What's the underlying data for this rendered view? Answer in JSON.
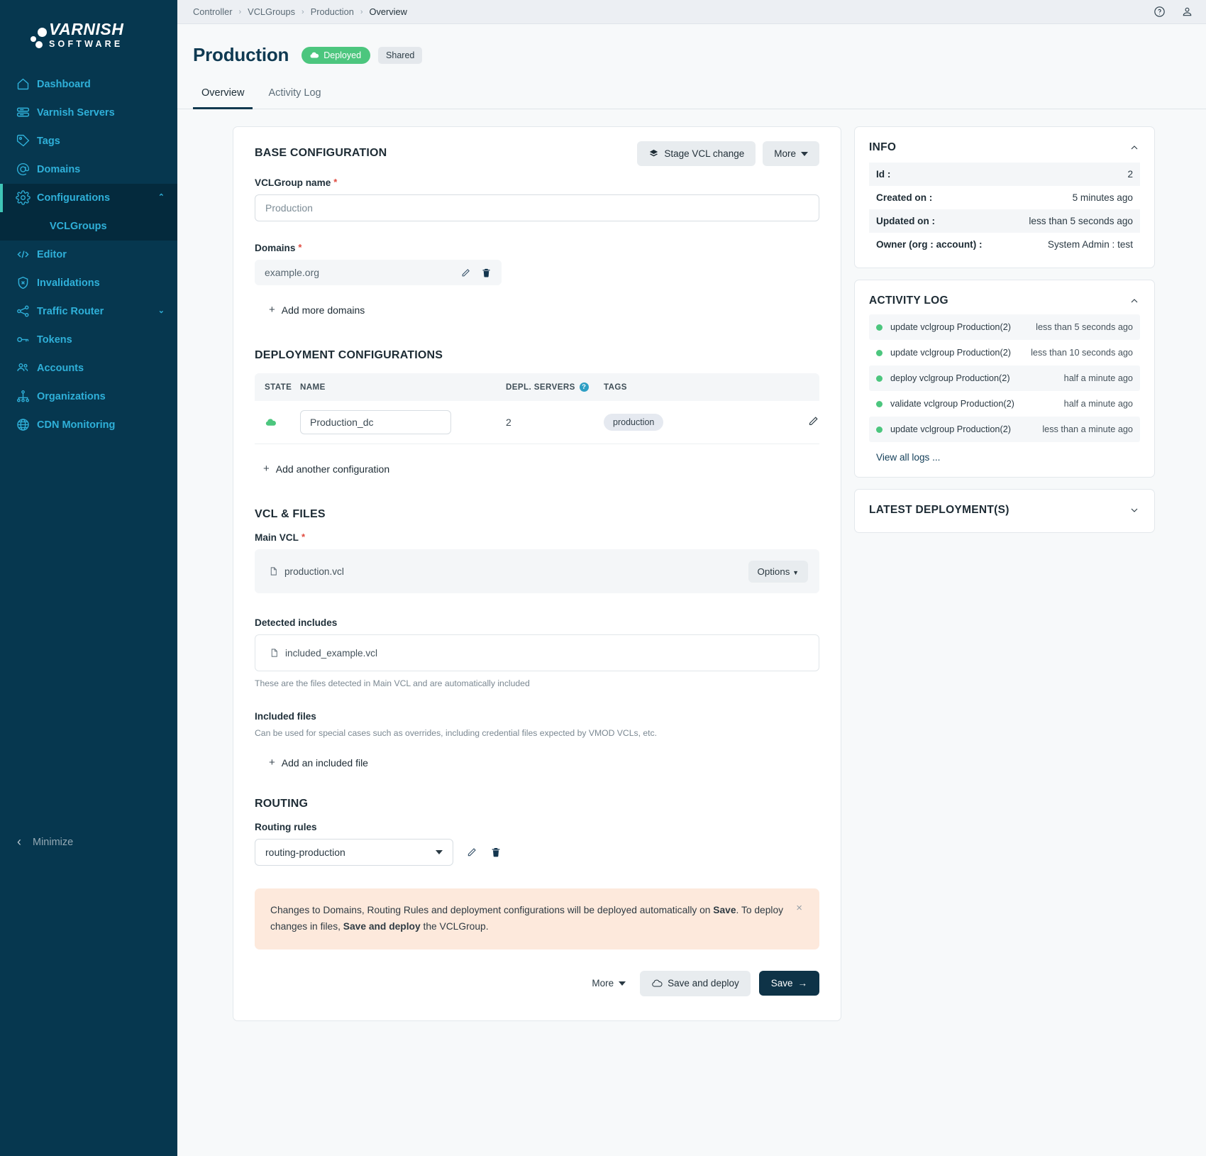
{
  "sidebar": {
    "logo": {
      "main": "VARNISH",
      "sub": "SOFTWARE"
    },
    "items": [
      {
        "label": "Dashboard",
        "icon": "home-icon"
      },
      {
        "label": "Varnish Servers",
        "icon": "servers-icon"
      },
      {
        "label": "Tags",
        "icon": "tag-icon"
      },
      {
        "label": "Domains",
        "icon": "at-icon"
      },
      {
        "label": "Configurations",
        "icon": "gear-icon",
        "expanded": true,
        "chevron": "⌃"
      },
      {
        "label": "Editor",
        "icon": "code-icon"
      },
      {
        "label": "Invalidations",
        "icon": "shield-icon"
      },
      {
        "label": "Traffic Router",
        "icon": "share-icon",
        "chevron": "⌄"
      },
      {
        "label": "Tokens",
        "icon": "key-icon"
      },
      {
        "label": "Accounts",
        "icon": "users-icon"
      },
      {
        "label": "Organizations",
        "icon": "org-icon"
      },
      {
        "label": "CDN Monitoring",
        "icon": "globe-icon"
      }
    ],
    "subitem": "VCLGroups",
    "minimize": "Minimize"
  },
  "topbar": {
    "breadcrumb": [
      "Controller",
      "VCLGroups",
      "Production",
      "Overview"
    ],
    "separator": "›",
    "help_icon": "help-circle-icon",
    "user_icon": "user-icon"
  },
  "header": {
    "title": "Production",
    "status_badge": "Deployed",
    "shared_badge": "Shared",
    "status_color": "#4cc67e"
  },
  "tabs": [
    {
      "label": "Overview",
      "active": true
    },
    {
      "label": "Activity Log",
      "active": false
    }
  ],
  "base_config": {
    "heading": "BASE CONFIGURATION",
    "stage_button": "Stage VCL change",
    "more_button": "More",
    "name_label": "VCLGroup name",
    "name_value": "Production",
    "domains_label": "Domains",
    "domains": [
      "example.org"
    ],
    "add_domains": "Add more domains",
    "required_mark": "*"
  },
  "deployment": {
    "heading": "DEPLOYMENT CONFIGURATIONS",
    "columns": [
      "STATE",
      "NAME",
      "DEPL. SERVERS",
      "TAGS"
    ],
    "help_glyph": "?",
    "rows": [
      {
        "state": "deployed",
        "name": "Production_dc",
        "servers": "2",
        "tag": "production"
      }
    ],
    "add_config": "Add another configuration"
  },
  "vcl_files": {
    "heading": "VCL & FILES",
    "main_vcl_label": "Main VCL",
    "main_vcl_file": "production.vcl",
    "options_button": "Options",
    "detected_label": "Detected includes",
    "detected_file": "included_example.vcl",
    "detected_help": "These are the files detected in Main VCL and are automatically included",
    "included_label": "Included files",
    "included_help": "Can be used for special cases such as overrides, including credential files expected by VMOD VCLs, etc.",
    "add_included": "Add an included file"
  },
  "routing": {
    "heading": "ROUTING",
    "rules_label": "Routing rules",
    "selected_rule": "routing-production"
  },
  "alert": {
    "part1": "Changes to Domains, Routing Rules and deployment configurations will be deployed automatically on ",
    "bold1": "Save",
    "part2": ". To deploy changes in files, ",
    "bold2": "Save and deploy",
    "part3": " the VCLGroup.",
    "close": "×"
  },
  "footer": {
    "more": "More",
    "save_and_deploy": "Save and deploy",
    "save": "Save"
  },
  "info_panel": {
    "title": "INFO",
    "rows": [
      {
        "key": "Id :",
        "value": "2"
      },
      {
        "key": "Created on :",
        "value": "5 minutes ago"
      },
      {
        "key": "Updated on :",
        "value": "less than 5 seconds ago"
      },
      {
        "key": "Owner (org : account) :",
        "value": "System Admin : test"
      }
    ]
  },
  "activity_panel": {
    "title": "ACTIVITY LOG",
    "entries": [
      {
        "label": "update vclgroup Production(2)",
        "time": "less than 5 seconds ago"
      },
      {
        "label": "update vclgroup Production(2)",
        "time": "less than 10 seconds ago"
      },
      {
        "label": "deploy vclgroup Production(2)",
        "time": "half a minute ago"
      },
      {
        "label": "validate vclgroup Production(2)",
        "time": "half a minute ago"
      },
      {
        "label": "update vclgroup Production(2)",
        "time": "less than a minute ago"
      }
    ],
    "view_all": "View all logs ..."
  },
  "deploy_panel": {
    "title": "LATEST DEPLOYMENT(S)"
  }
}
